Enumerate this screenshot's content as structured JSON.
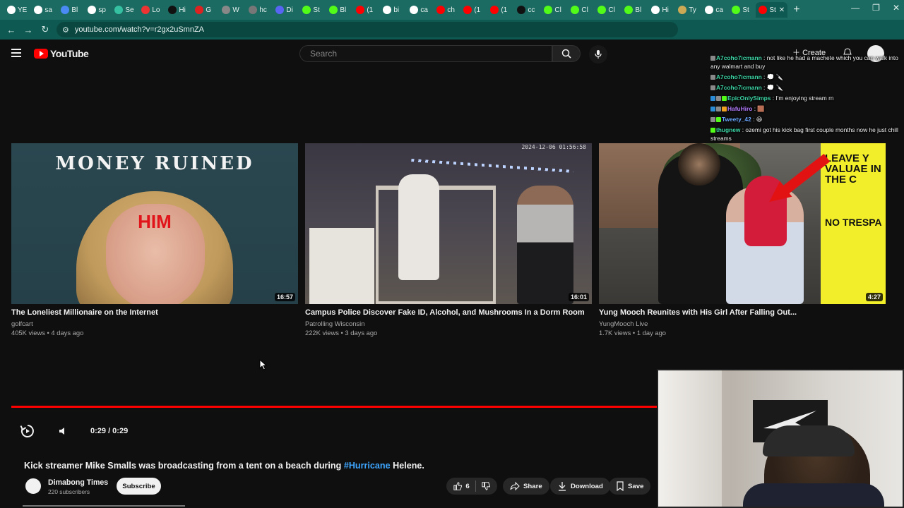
{
  "browser": {
    "tabs": [
      {
        "label": "YE",
        "color": "#ffffff"
      },
      {
        "label": "sa",
        "color": "#ffffff"
      },
      {
        "label": "Bl",
        "color": "#4a8af4"
      },
      {
        "label": "sp",
        "color": "#ffffff"
      },
      {
        "label": "Se",
        "color": "#35c1a1"
      },
      {
        "label": "Lo",
        "color": "#e33"
      },
      {
        "label": "Hi",
        "color": "#111111"
      },
      {
        "label": "G",
        "color": "#d22"
      },
      {
        "label": "W",
        "color": "#888888"
      },
      {
        "label": "hc",
        "color": "#777777"
      },
      {
        "label": "Di",
        "color": "#5865f2"
      },
      {
        "label": "St",
        "color": "#53fc18"
      },
      {
        "label": "Bl",
        "color": "#53fc18"
      },
      {
        "label": "(1",
        "color": "#ff0000"
      },
      {
        "label": "bi",
        "color": "#ffffff"
      },
      {
        "label": "ca",
        "color": "#ffffff"
      },
      {
        "label": "ch",
        "color": "#ff0000"
      },
      {
        "label": "(1",
        "color": "#ff0000"
      },
      {
        "label": "(1",
        "color": "#ff0000"
      },
      {
        "label": "cc",
        "color": "#111111"
      },
      {
        "label": "Cl",
        "color": "#53fc18"
      },
      {
        "label": "Cl",
        "color": "#53fc18"
      },
      {
        "label": "Cl",
        "color": "#53fc18"
      },
      {
        "label": "Bl",
        "color": "#53fc18"
      },
      {
        "label": "Hi",
        "color": "#ffffff"
      },
      {
        "label": "Ty",
        "color": "#ccaa55"
      },
      {
        "label": "ca",
        "color": "#ffffff"
      },
      {
        "label": "St",
        "color": "#53fc18"
      },
      {
        "label": "St",
        "color": "#ff0000",
        "active": true
      }
    ],
    "url": "youtube.com/watch?v=r2gx2uSmnZA"
  },
  "youtube": {
    "logo_text": "YouTube",
    "search_placeholder": "Search",
    "create_label": "Create"
  },
  "chat": [
    {
      "user": "A7coho7icmann",
      "user_color": "#3dd6a6",
      "badges": [
        "#8a8a8a"
      ],
      "text": " : not like he had a machete which you can walk into any walmart and buy"
    },
    {
      "user": "A7coho7icmann",
      "user_color": "#3dd6a6",
      "badges": [
        "#8a8a8a"
      ],
      "text": " : 💭 🔪"
    },
    {
      "user": "A7coho7icmann",
      "user_color": "#3dd6a6",
      "badges": [
        "#8a8a8a"
      ],
      "text": " : 💭 🔪"
    },
    {
      "user": "EpicOnlySimps",
      "user_color": "#3dd6a6",
      "badges": [
        "#2a8ad4",
        "#8a8a8a",
        "#53fc18"
      ],
      "text": " : I'm enjoying stream rn"
    },
    {
      "user": "HafuHiro",
      "user_color": "#b47cff",
      "badges": [
        "#2a8ad4",
        "#8a8a8a",
        "#f0a020"
      ],
      "text": " : 🟫"
    },
    {
      "user": "Tweety_42",
      "user_color": "#6aa8ff",
      "badges": [
        "#8a8a8a",
        "#53fc18"
      ],
      "text": " : 😄"
    },
    {
      "user": "thugnew",
      "user_color": "#3dd6a6",
      "badges": [
        "#53fc18"
      ],
      "text": " : ozemi got his kick bag first couple months now he just chill streams"
    }
  ],
  "videos": [
    {
      "title": "The Loneliest Millionaire on the Internet",
      "channel": "golfcart",
      "meta": "405K views • 4 days ago",
      "duration": "16:57",
      "thumb_title": "MONEY RUINED",
      "thumb_word": "HIM"
    },
    {
      "title": "Campus Police Discover Fake ID, Alcohol, and Mushrooms In a Dorm Room",
      "channel": "Patrolling Wisconsin",
      "meta": "222K views • 3 days ago",
      "duration": "16:01",
      "thumb_timestamp": "2024-12-06 01:56:58"
    },
    {
      "title": "Yung Mooch Reunites with His Girl After Falling Out...",
      "channel": "YungMooch Live",
      "meta": "1.7K views • 1 day ago",
      "duration": "4:27",
      "thumb_sign": "LEAVE Y VALUAE IN THE C",
      "thumb_sign2": "NO TRESPA"
    }
  ],
  "player": {
    "time": "0:29 / 0:29",
    "progress": 1.0
  },
  "video_info": {
    "title_before": "Kick streamer Mike Smalls was broadcasting from a tent on a beach during ",
    "title_tag": "#Hurricane",
    "title_after": " Helene.",
    "channel_name": "Dimabong Times",
    "subscribers": "220 subscribers",
    "subscribe_label": "Subscribe",
    "likes": "6",
    "share_label": "Share",
    "download_label": "Download",
    "save_label": "Save"
  }
}
